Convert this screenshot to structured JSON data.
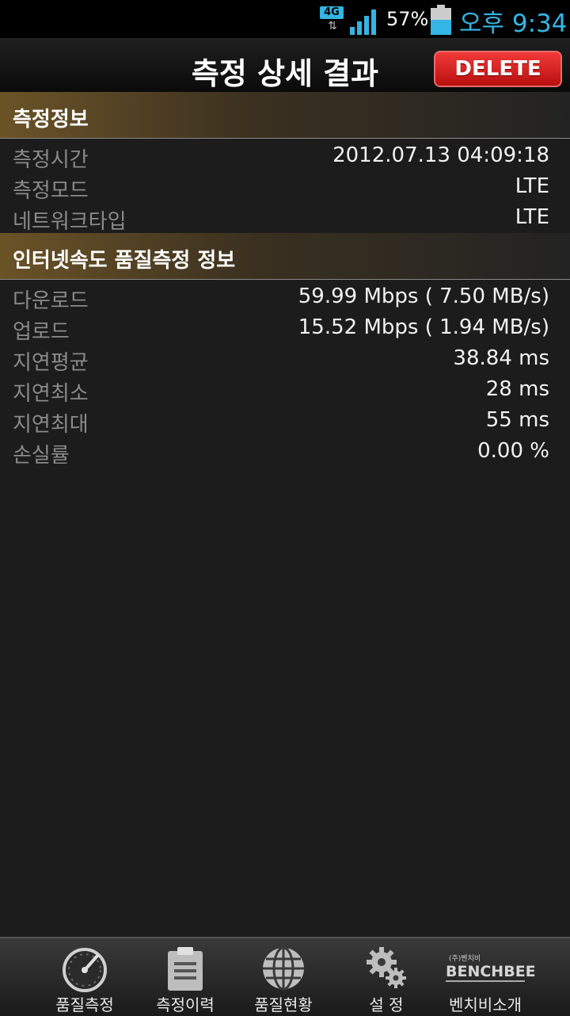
{
  "status_bar": {
    "network": "4G",
    "battery_percent": "57%",
    "battery_level": 0.57,
    "clock": "오후 9:34"
  },
  "header": {
    "title": "측정 상세 결과",
    "delete_label": "DELETE"
  },
  "measurement_info": {
    "heading": "측정정보",
    "rows": [
      {
        "label": "측정시간",
        "value": "2012.07.13 04:09:18"
      },
      {
        "label": "측정모드",
        "value": "LTE"
      },
      {
        "label": "네트워크타입",
        "value": "LTE"
      }
    ]
  },
  "quality_info": {
    "heading": "인터넷속도 품질측정 정보",
    "rows": [
      {
        "label": "다운로드",
        "value": "59.99 Mbps ( 7.50 MB/s)"
      },
      {
        "label": "업로드",
        "value": "15.52 Mbps ( 1.94 MB/s)"
      },
      {
        "label": "지연평균",
        "value": "38.84 ms"
      },
      {
        "label": "지연최소",
        "value": "28 ms"
      },
      {
        "label": "지연최대",
        "value": "55 ms"
      },
      {
        "label": "손실률",
        "value": "0.00 %"
      }
    ]
  },
  "bottom_nav": {
    "items": [
      {
        "label": "품질측정",
        "icon": "speedometer-icon"
      },
      {
        "label": "측정이력",
        "icon": "clipboard-icon"
      },
      {
        "label": "품질현황",
        "icon": "globe-icon"
      },
      {
        "label": "설 정",
        "icon": "gears-icon"
      },
      {
        "label": "벤치비소개",
        "icon": "benchbee-logo",
        "logo_small": "(주)벤치비",
        "logo_text": "BENCHBEE"
      }
    ]
  },
  "colors": {
    "accent": "#33b5e5",
    "delete": "#d81c1c",
    "label_gray": "#8a8a8a"
  }
}
